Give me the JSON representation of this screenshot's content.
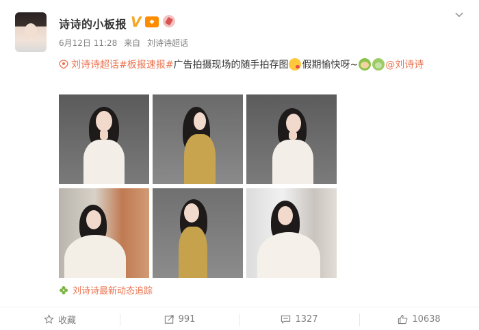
{
  "post": {
    "username": "诗诗的小板报",
    "time": "6月12日 11:28",
    "source_prefix": "来自",
    "source": "刘诗诗超话",
    "content": {
      "topic_link": "刘诗诗超话",
      "hashtag": "#板报速报#",
      "text": "广告拍摄现场的随手拍存图",
      "text_after": "假期愉快呀~",
      "mention": "@刘诗诗"
    },
    "follow_link": "刘诗诗最新动态追踪"
  },
  "actions": {
    "favorite_label": "收藏",
    "repost_count": "991",
    "comment_count": "1327",
    "like_count": "10638"
  },
  "icons": [
    "verified-icon",
    "vip-icon",
    "badge-icon",
    "chevron-down-icon",
    "topic-icon",
    "kiss-emoji",
    "monkey-emoji",
    "bear-emoji",
    "clover-icon",
    "star-icon",
    "repost-icon",
    "comment-icon",
    "like-icon"
  ],
  "colors": {
    "link": "#eb7350",
    "verified": "#f5a623",
    "muted": "#808080"
  }
}
